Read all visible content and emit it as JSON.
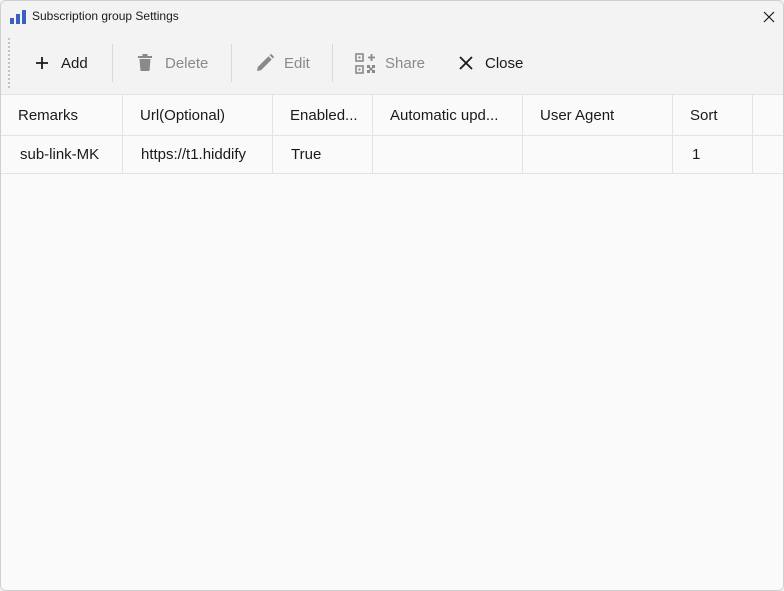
{
  "window": {
    "title": "Subscription group Settings",
    "accent_color": "#3b5fc0"
  },
  "toolbar": {
    "add_label": "Add",
    "delete_label": "Delete",
    "edit_label": "Edit",
    "share_label": "Share",
    "close_label": "Close"
  },
  "grid": {
    "columns": [
      "Remarks",
      "Url(Optional)",
      "Enabled...",
      "Automatic upd...",
      "User Agent",
      "Sort"
    ],
    "rows": [
      [
        "sub-link-MK",
        "https://t1.hiddify",
        "True",
        "",
        "",
        "1"
      ]
    ]
  }
}
